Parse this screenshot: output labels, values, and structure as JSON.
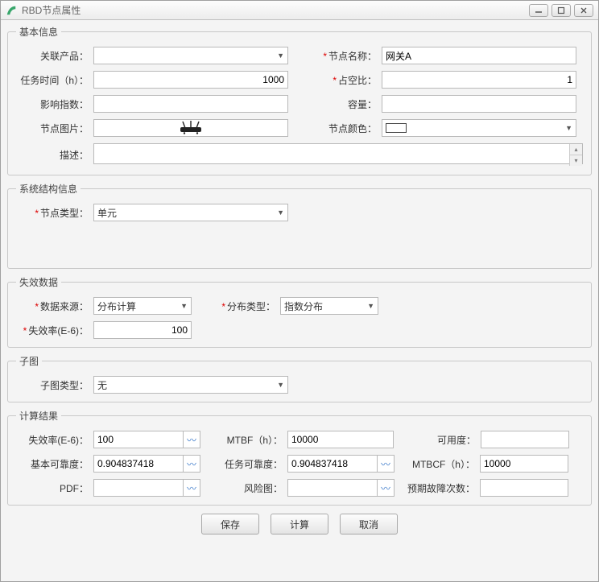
{
  "window": {
    "title": "RBD节点属性"
  },
  "basic": {
    "legend": "基本信息",
    "assoc_product_label": "关联产品：",
    "assoc_product_value": "",
    "node_name_label": "节点名称：",
    "node_name_value": "网关A",
    "task_time_label": "任务时间（h）：",
    "task_time_value": "1000",
    "duty_ratio_label": "占空比：",
    "duty_ratio_value": "1",
    "impact_index_label": "影响指数：",
    "impact_index_value": "",
    "capacity_label": "容量：",
    "capacity_value": "",
    "node_image_label": "节点图片：",
    "node_color_label": "节点颜色：",
    "node_color_value": "#ffffff",
    "description_label": "描述："
  },
  "structure": {
    "legend": "系统结构信息",
    "node_type_label": "节点类型：",
    "node_type_value": "单元"
  },
  "failure": {
    "legend": "失效数据",
    "data_source_label": "数据来源：",
    "data_source_value": "分布计算",
    "dist_type_label": "分布类型：",
    "dist_type_value": "指数分布",
    "failure_rate_label": "失效率(E-6)：",
    "failure_rate_value": "100"
  },
  "subgraph": {
    "legend": "子图",
    "type_label": "子图类型：",
    "type_value": "无"
  },
  "results": {
    "legend": "计算结果",
    "fr_label": "失效率(E-6)：",
    "fr_value": "100",
    "mtbf_label": "MTBF（h）：",
    "mtbf_value": "10000",
    "avail_label": "可用度：",
    "avail_value": "",
    "basic_rel_label": "基本可靠度：",
    "basic_rel_value": "0.904837418",
    "task_rel_label": "任务可靠度：",
    "task_rel_value": "0.904837418",
    "mtbcf_label": "MTBCF（h）：",
    "mtbcf_value": "10000",
    "pdf_label": "PDF：",
    "risk_label": "风险图：",
    "expected_fail_label": "预期故障次数：",
    "expected_fail_value": ""
  },
  "buttons": {
    "save": "保存",
    "calc": "计算",
    "cancel": "取消"
  }
}
